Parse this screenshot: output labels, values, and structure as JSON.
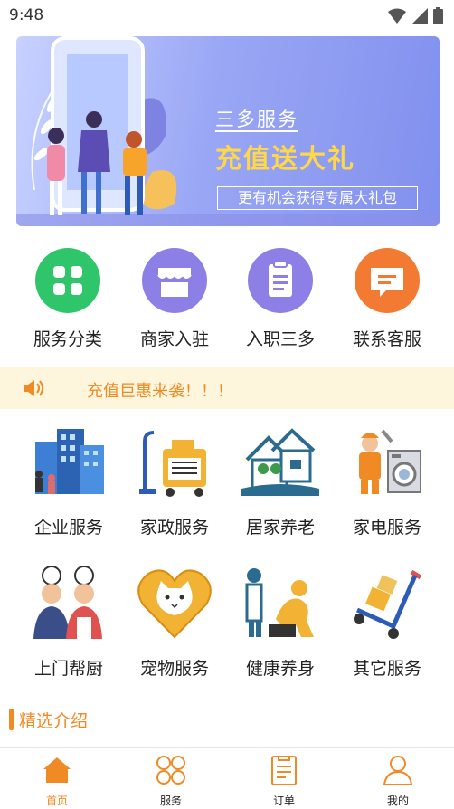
{
  "status_bar": {
    "time": "9:48"
  },
  "banner": {
    "brand": "三多服务",
    "title": "充值送大礼",
    "subtitle": "更有机会获得专属大礼包",
    "active_dot": 3
  },
  "quick_menu": [
    {
      "label": "服务分类",
      "icon": "grid-icon",
      "color": "#2fc56a"
    },
    {
      "label": "商家入驻",
      "icon": "shop-icon",
      "color": "#8c7fe6"
    },
    {
      "label": "入职三多",
      "icon": "clipboard-icon",
      "color": "#8c7fe6"
    },
    {
      "label": "联系客服",
      "icon": "chat-icon",
      "color": "#f27a33"
    }
  ],
  "notice": {
    "text": "充值巨惠来袭！！！",
    "icon": "speaker-icon"
  },
  "services": [
    {
      "label": "企业服务",
      "icon": "office-building-icon"
    },
    {
      "label": "家政服务",
      "icon": "vacuum-cleaner-icon"
    },
    {
      "label": "居家养老",
      "icon": "elderly-home-icon"
    },
    {
      "label": "家电服务",
      "icon": "appliance-repair-icon"
    },
    {
      "label": "上门帮厨",
      "icon": "chef-icon"
    },
    {
      "label": "宠物服务",
      "icon": "cat-heart-icon"
    },
    {
      "label": "健康养身",
      "icon": "massage-icon"
    },
    {
      "label": "其它服务",
      "icon": "hand-truck-icon"
    }
  ],
  "section": {
    "title": "精选介绍"
  },
  "tabbar": [
    {
      "label": "首页",
      "icon": "home-icon",
      "active": true
    },
    {
      "label": "服务",
      "icon": "services-icon",
      "active": false
    },
    {
      "label": "订单",
      "icon": "order-icon",
      "active": false
    },
    {
      "label": "我的",
      "icon": "user-icon",
      "active": false
    }
  ],
  "colors": {
    "accent": "#f08a24",
    "notice_bg": "#fdf6dc",
    "banner": "#8190ee"
  }
}
